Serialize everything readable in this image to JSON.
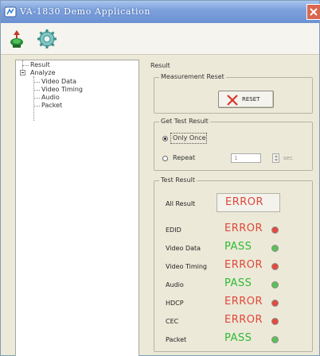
{
  "window": {
    "title": "VA-1830 Demo Application"
  },
  "colors": {
    "error": "#e0473a",
    "pass": "#2dbb35",
    "led_error": "#e64a3c",
    "led_pass": "#58c353"
  },
  "toolbar": {
    "icons": [
      "connect-icon",
      "settings-gear-icon"
    ]
  },
  "tree": {
    "items": [
      {
        "label": "Result"
      },
      {
        "label": "Analyze"
      },
      {
        "label": "Video Data"
      },
      {
        "label": "Video Timing"
      },
      {
        "label": "Audio"
      },
      {
        "label": "Packet"
      }
    ]
  },
  "content": {
    "section_title": "Result",
    "measurement_reset": {
      "group_title": "Measurement Reset",
      "button_label": "RESET"
    },
    "get_test_result": {
      "group_title": "Get Test Result",
      "option_once": "Only Once",
      "option_repeat": "Repeat",
      "repeat_value": "1",
      "repeat_unit": "sec",
      "selected": "Only Once"
    },
    "test_result": {
      "group_title": "Test Result",
      "all_result_label": "All Result",
      "all_result_value": "ERROR",
      "rows": [
        {
          "label": "EDID",
          "value": "ERROR",
          "status": "error"
        },
        {
          "label": "Video Data",
          "value": "PASS",
          "status": "pass"
        },
        {
          "label": "Video Timing",
          "value": "ERROR",
          "status": "error"
        },
        {
          "label": "Audio",
          "value": "PASS",
          "status": "pass"
        },
        {
          "label": "HDCP",
          "value": "ERROR",
          "status": "error"
        },
        {
          "label": "CEC",
          "value": "ERROR",
          "status": "error"
        },
        {
          "label": "Packet",
          "value": "PASS",
          "status": "pass"
        }
      ]
    }
  }
}
